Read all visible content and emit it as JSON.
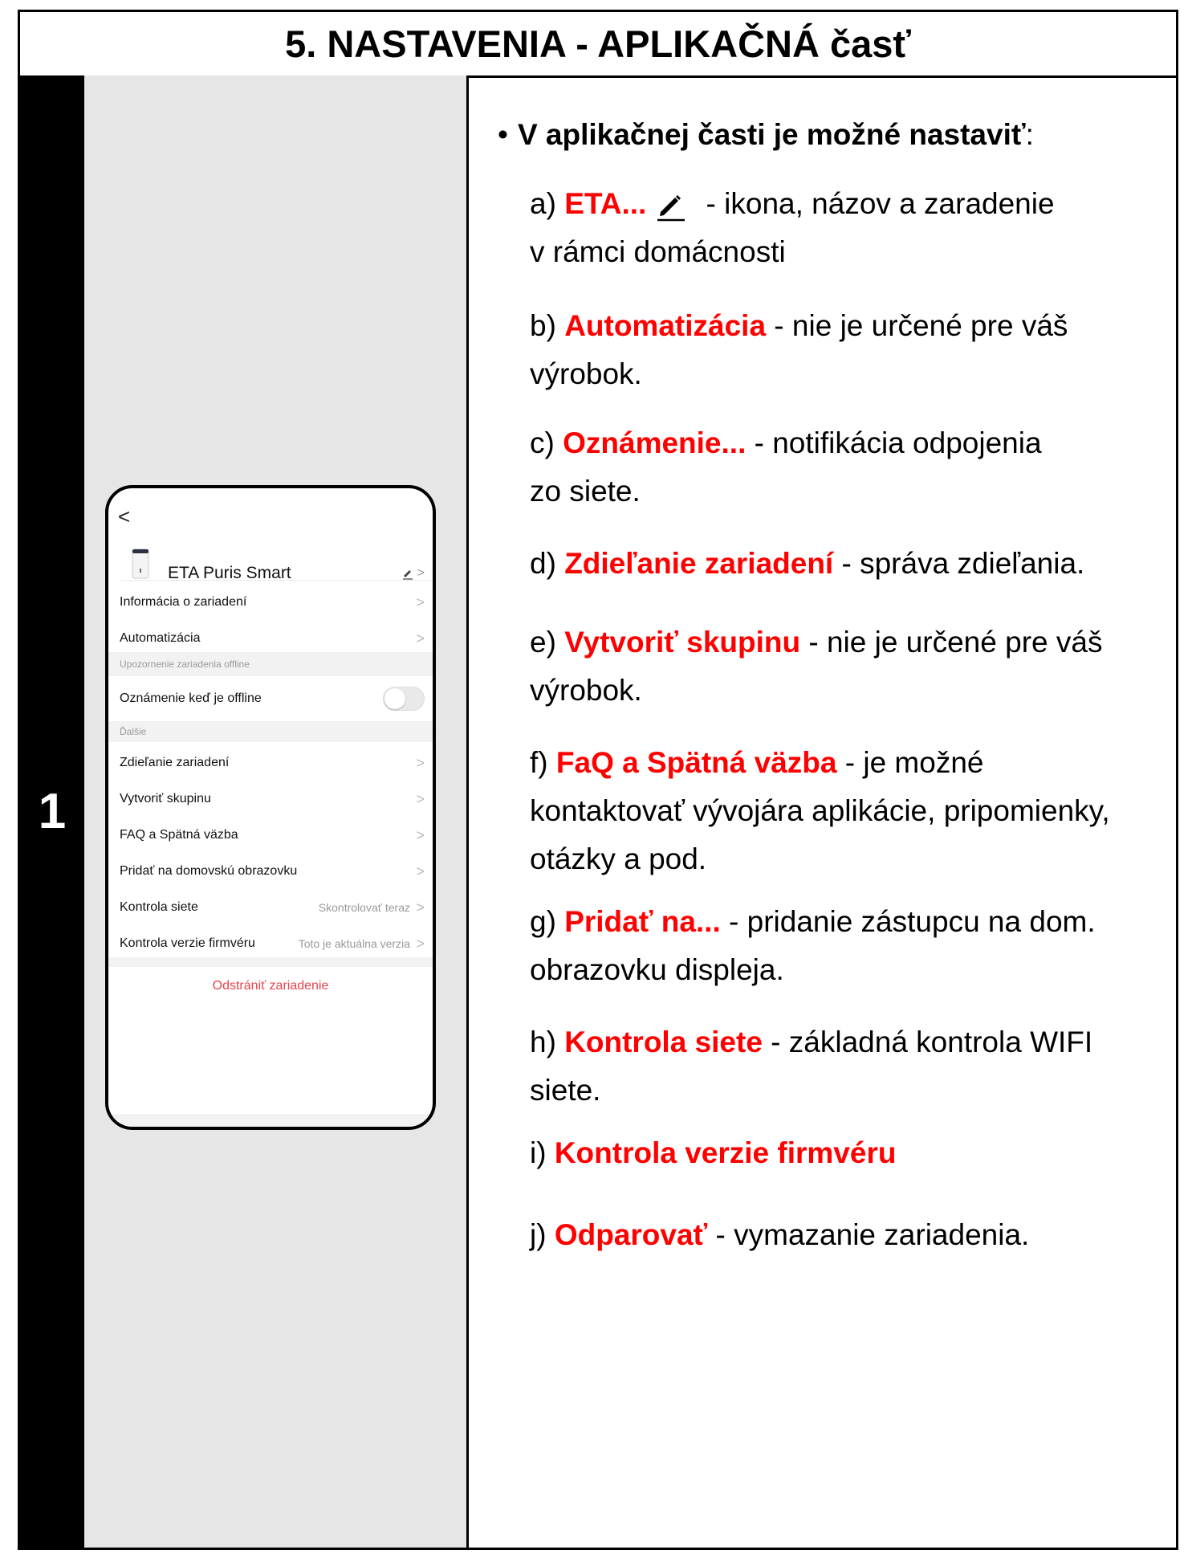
{
  "title": "5. NASTAVENIA - APLIKAČNÁ časť",
  "step_number": "1",
  "intro": {
    "bullet": "•",
    "bold": "V aplikačnej časti je možné nastaviť",
    "suffix": ":"
  },
  "items": [
    {
      "prefix": "a) ",
      "key": "ETA...",
      "text": " - ikona, názov a zaradenie",
      "text2": "v rámci domácnosti",
      "icon": "pencil-icon"
    },
    {
      "prefix": "b) ",
      "key": "Automatizácia",
      "text": " - nie je určené pre váš",
      "text2": "výrobok."
    },
    {
      "prefix": "c) ",
      "key": "Oznámenie...",
      "text": " - notifikácia odpojenia",
      "text2": "zo siete."
    },
    {
      "prefix": "d) ",
      "key": "Zdieľanie zariadení",
      "text": " - správa zdieľania."
    },
    {
      "prefix": "e) ",
      "key": "Vytvoriť skupinu",
      "text": " - nie je určené pre váš",
      "text2": "výrobok."
    },
    {
      "prefix": "f) ",
      "key": "FaQ a Spätná väzba",
      "text": " - je možné",
      "text2": "kontaktovať vývojára aplikácie, pripomienky,",
      "text3": "otázky a pod."
    },
    {
      "prefix": "g) ",
      "key": "Pridať na...",
      "text": " - pridanie zástupcu na dom.",
      "text2": "obrazovku displeja."
    },
    {
      "prefix": "h) ",
      "key": "Kontrola siete",
      "text": " - základná kontrola WIFI",
      "text2": "siete."
    },
    {
      "prefix": "i) ",
      "key": "Kontrola verzie firmvéru"
    },
    {
      "prefix": "j) ",
      "key": "Odparovať",
      "text": " - vymazanie zariadenia."
    }
  ],
  "phone": {
    "back": "<",
    "device_name": "ETA Puris Smart",
    "chevron": ">",
    "rows": {
      "info": "Informácia o zariadení",
      "automation": "Automatizácia",
      "offline_section": "Upozornenie zariadenia offline",
      "offline_notify": "Oznámenie keď je offline",
      "more_section": "Ďalšie",
      "sharing": "Zdieľanie zariadení",
      "group": "Vytvoriť skupinu",
      "faq": "FAQ a Spätná väzba",
      "homescreen": "Pridať na domovskú obrazovku",
      "network": "Kontrola siete",
      "network_value": "Skontrolovať teraz",
      "firmware": "Kontrola verzie firmvéru",
      "firmware_value": "Toto je aktuálna verzia",
      "remove": "Odstrániť zariadenie"
    },
    "offline_toggle_on": false,
    "accent_color": "#e8424a"
  },
  "colors": {
    "highlight": "#ff0000",
    "step_bg": "#000000",
    "image_bg": "#e6e6e6"
  }
}
